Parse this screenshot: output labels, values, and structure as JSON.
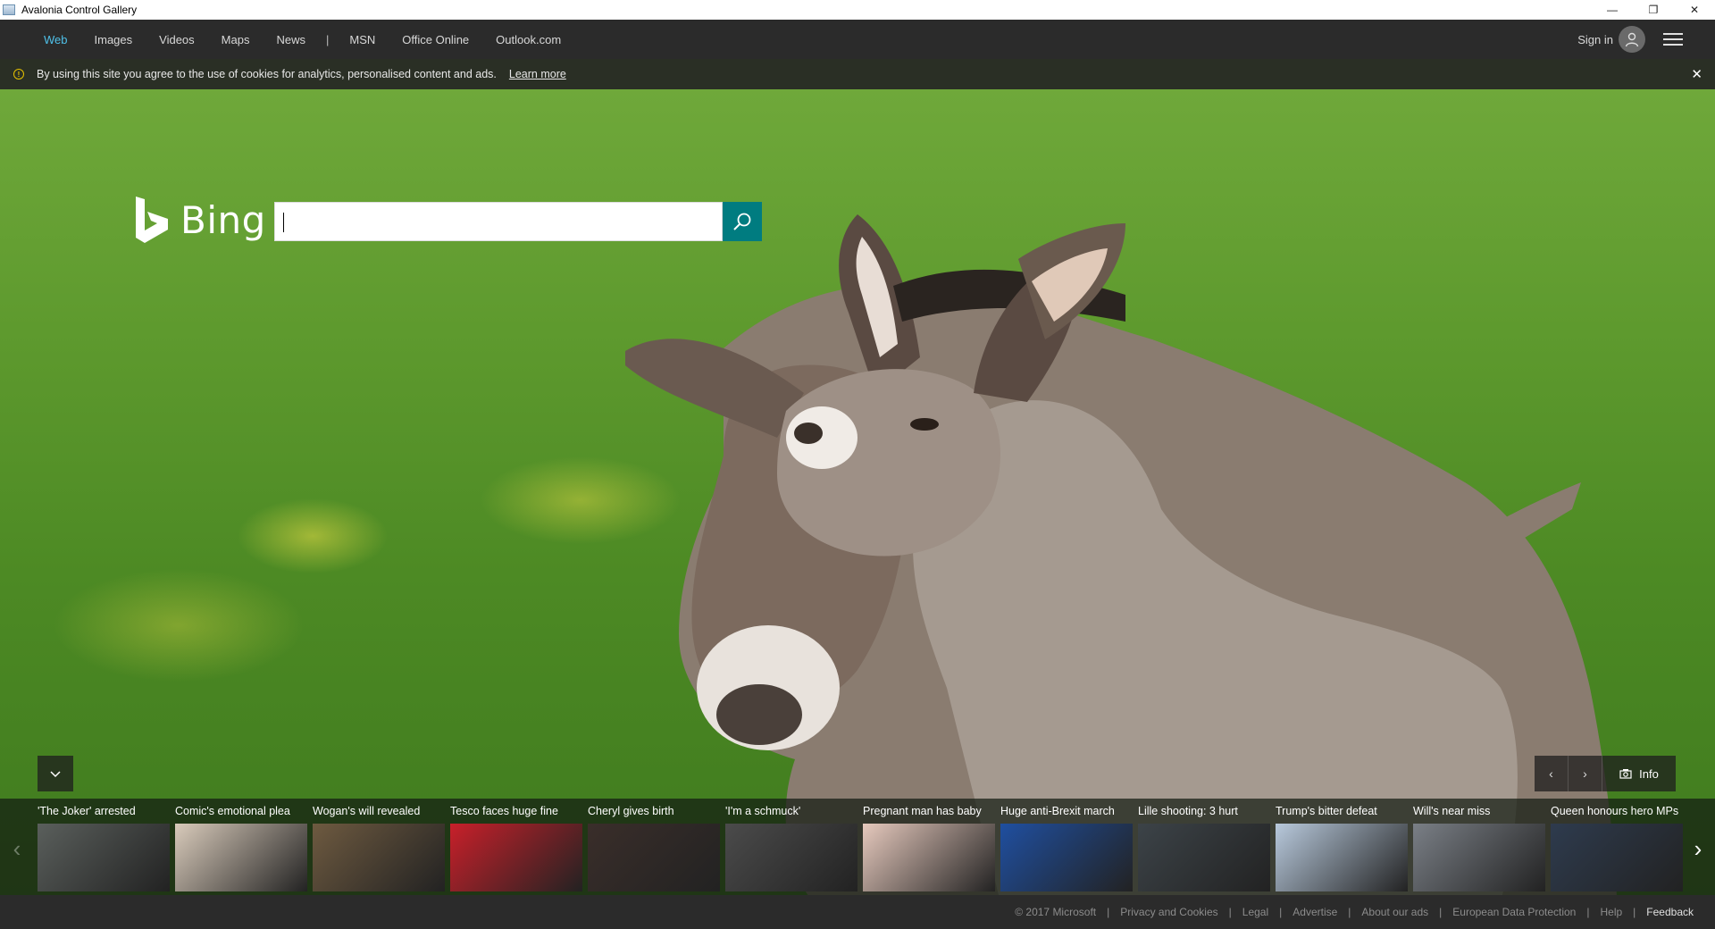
{
  "window": {
    "title": "Avalonia Control Gallery",
    "minimize_glyph": "—",
    "restore_glyph": "❐",
    "close_glyph": "✕"
  },
  "nav": {
    "links": [
      "Web",
      "Images",
      "Videos",
      "Maps",
      "News"
    ],
    "separator": "|",
    "links2": [
      "MSN",
      "Office Online",
      "Outlook.com"
    ],
    "active": "Web",
    "active_color": "#4fc1e9",
    "sign_in": "Sign in"
  },
  "cookie": {
    "message": "By using this site you agree to the use of cookies for analytics, personalised content and ads.",
    "learn_more": "Learn more",
    "info_glyph": "!",
    "close_glyph": "✕"
  },
  "search": {
    "brand": "Bing",
    "query": "",
    "placeholder": "",
    "accent": "#007c80"
  },
  "hero": {
    "info_label": "Info",
    "prev_glyph": "‹",
    "next_glyph": "›",
    "collapse_glyph": "⌄"
  },
  "news": {
    "items": [
      {
        "caption": "'The Joker' arrested",
        "color": "#5a5f5c"
      },
      {
        "caption": "Comic's emotional plea",
        "color": "#d9cbbb"
      },
      {
        "caption": "Wogan's will revealed",
        "color": "#6e5a40"
      },
      {
        "caption": "Tesco faces huge fine",
        "color": "#c8202a"
      },
      {
        "caption": "Cheryl gives birth",
        "color": "#3a2e2a"
      },
      {
        "caption": "'I'm a schmuck'",
        "color": "#4b4b4b"
      },
      {
        "caption": "Pregnant man has baby",
        "color": "#e6c9bd"
      },
      {
        "caption": "Huge anti-Brexit march",
        "color": "#1f4fa0"
      },
      {
        "caption": "Lille shooting: 3 hurt",
        "color": "#3c4348"
      },
      {
        "caption": "Trump's bitter defeat",
        "color": "#b8c9dc"
      },
      {
        "caption": "Will's near miss",
        "color": "#7a7f86"
      },
      {
        "caption": "Queen honours hero MPs",
        "color": "#2e3b4e"
      }
    ],
    "prev_glyph": "‹",
    "next_glyph": "›"
  },
  "footer": {
    "links": [
      "© 2017 Microsoft",
      "Privacy and Cookies",
      "Legal",
      "Advertise",
      "About our ads",
      "European Data Protection",
      "Help"
    ],
    "feedback": "Feedback",
    "separator": "|"
  }
}
